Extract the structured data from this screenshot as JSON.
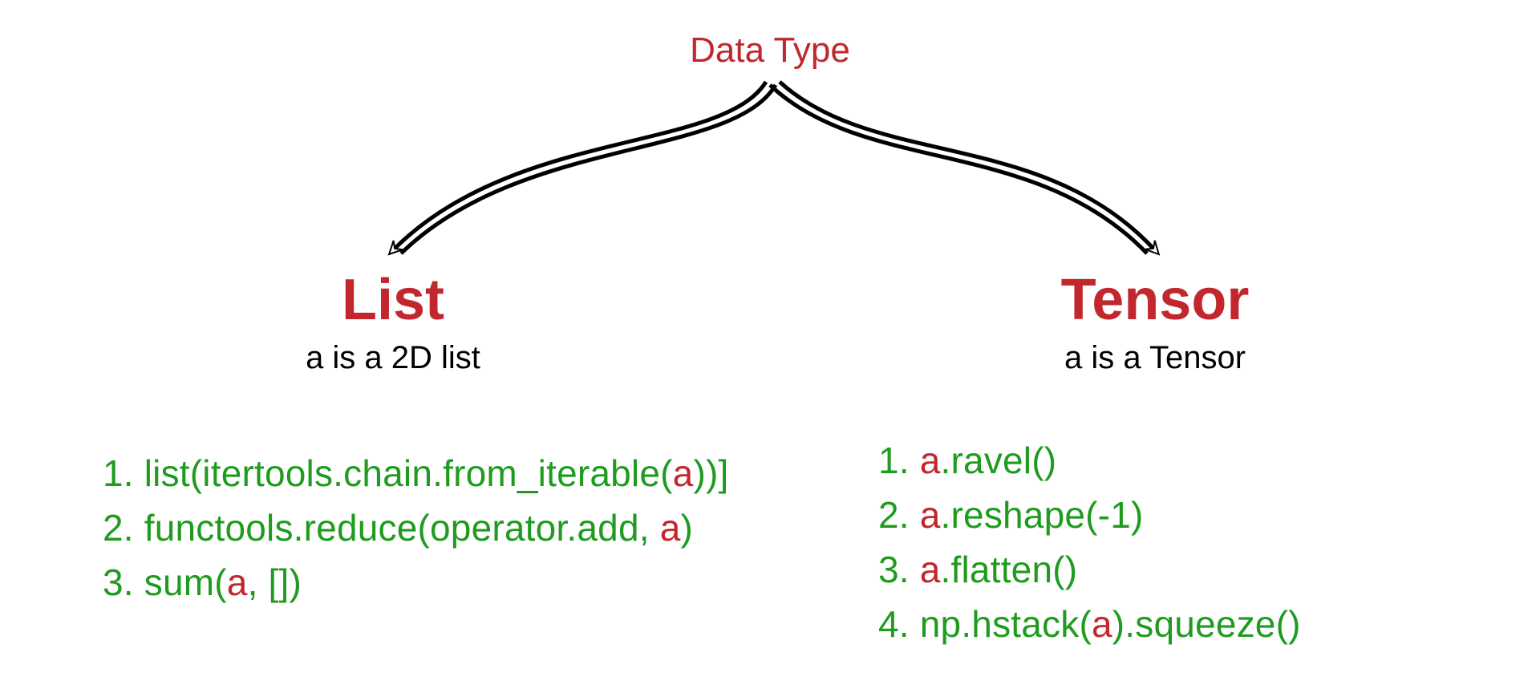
{
  "colors": {
    "red": "#c1272d",
    "green": "#1f9b1f",
    "black": "#000000"
  },
  "root": {
    "title": "Data Type"
  },
  "branches": {
    "left": {
      "title": "List",
      "subtitle": "a is a 2D list",
      "items": [
        {
          "num": "1. ",
          "pre": "list(itertools.chain.from_iterable(",
          "var": "a",
          "post": "))]"
        },
        {
          "num": "2. ",
          "pre": "functools.reduce(operator.add, ",
          "var": "a",
          "post": ")"
        },
        {
          "num": "3. ",
          "pre": "sum(",
          "var": "a",
          "post": ", [])"
        }
      ]
    },
    "right": {
      "title": "Tensor",
      "subtitle": "a is a Tensor",
      "items": [
        {
          "num": "1. ",
          "pre": "",
          "var": "a",
          "post": ".ravel()"
        },
        {
          "num": "2. ",
          "pre": "",
          "var": "a",
          "post": ".reshape(-1)"
        },
        {
          "num": "3. ",
          "pre": "",
          "var": "a",
          "post": ".flatten()"
        },
        {
          "num": "4. ",
          "pre": "np.hstack(",
          "var": "a",
          "post": ").squeeze()"
        }
      ]
    }
  }
}
